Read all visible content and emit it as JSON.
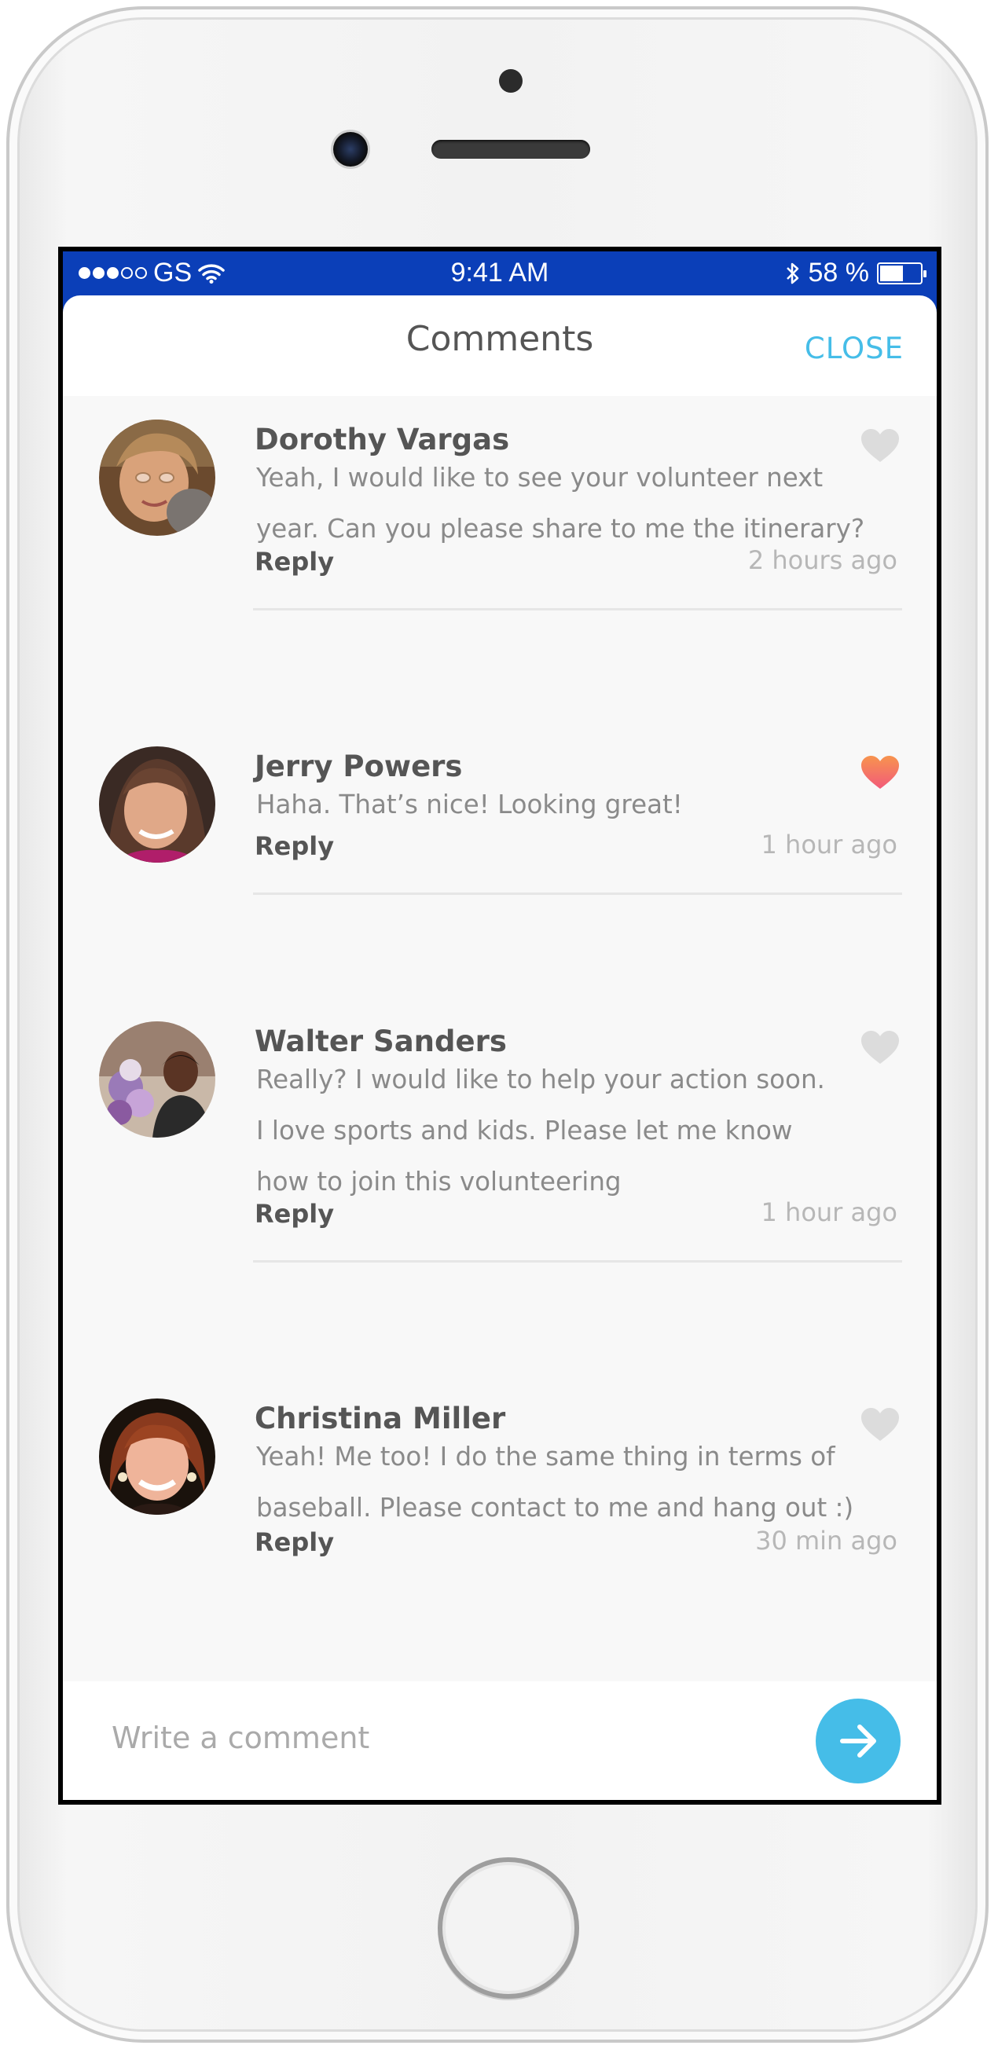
{
  "status_bar": {
    "carrier": "GS",
    "time": "9:41 AM",
    "battery": "58 %",
    "battery_level": 0.58,
    "signal_bars": 3,
    "signal_total": 5
  },
  "header": {
    "title": "Comments",
    "close_label": "CLOSE"
  },
  "comments": [
    {
      "name": "Dorothy Vargas",
      "text_lines": [
        "Yeah, I would like to see your volunteer next",
        "year. Can you please share to me the itinerary?"
      ],
      "reply_label": "Reply",
      "time": "2 hours ago",
      "liked": false
    },
    {
      "name": "Jerry Powers",
      "text_lines": [
        "Haha. That’s nice! Looking great!"
      ],
      "reply_label": "Reply",
      "time": "1 hour ago",
      "liked": true
    },
    {
      "name": "Walter Sanders",
      "text_lines": [
        "Really? I would like to help your action soon.",
        "I love sports and kids. Please let me know",
        "how to join this volunteering"
      ],
      "reply_label": "Reply",
      "time": "1 hour ago",
      "liked": false
    },
    {
      "name": "Christina Miller",
      "text_lines": [
        "Yeah! Me too! I do the same thing in terms of",
        "baseball. Please contact to me and hang out :)"
      ],
      "reply_label": "Reply",
      "time": "30 min ago",
      "liked": false
    }
  ],
  "composer": {
    "placeholder": "Write a comment",
    "value": ""
  },
  "colors": {
    "accent": "#45bde8",
    "status_bar": "#0b3fb8",
    "heart_liked": "#f46d6d",
    "heart_unliked": "#dcdcdc"
  }
}
